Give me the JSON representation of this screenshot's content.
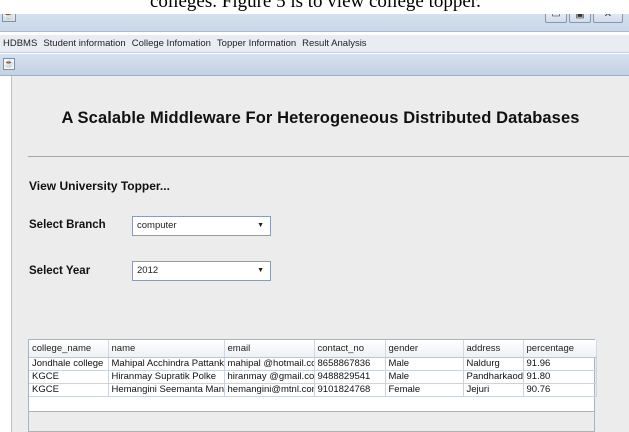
{
  "caption": "colleges. Figure 5 is to view college topper.",
  "window": {
    "app_icon": "java-cup-icon",
    "minimize": "▭",
    "maximize": "▣",
    "close": "✕"
  },
  "menubar": {
    "items": [
      "HDBMS",
      "Student information",
      "College Infomation",
      "Topper Information",
      "Result Analysis"
    ]
  },
  "inner_frame": {
    "icon": "java-cup-icon"
  },
  "main": {
    "heading": "A Scalable Middleware For Heterogeneous Distributed Databases",
    "section_title": "View University Topper...",
    "branch_label": "Select Branch",
    "branch_value": "computer",
    "year_label": "Select Year",
    "year_value": "2012"
  },
  "table": {
    "columns": [
      "college_name",
      "name",
      "email",
      "contact_no",
      "gender",
      "address",
      "percentage"
    ],
    "rows": [
      [
        "Jondhale college",
        "Mahipal Acchindra Pattankar",
        "mahipal @hotmail.com",
        "8658867836",
        "Male",
        "Naldurg",
        "91.96"
      ],
      [
        "KGCE",
        "Hiranmay Supratik Polke",
        "hiranmay @gmail.com",
        "9488829541",
        "Male",
        "Pandharkaoda",
        "91.80"
      ],
      [
        "KGCE",
        "Hemangini Seemanta Mande",
        "hemangini@mtnl.com",
        "9101824768",
        "Female",
        "Jejuri",
        "90.76"
      ]
    ]
  }
}
